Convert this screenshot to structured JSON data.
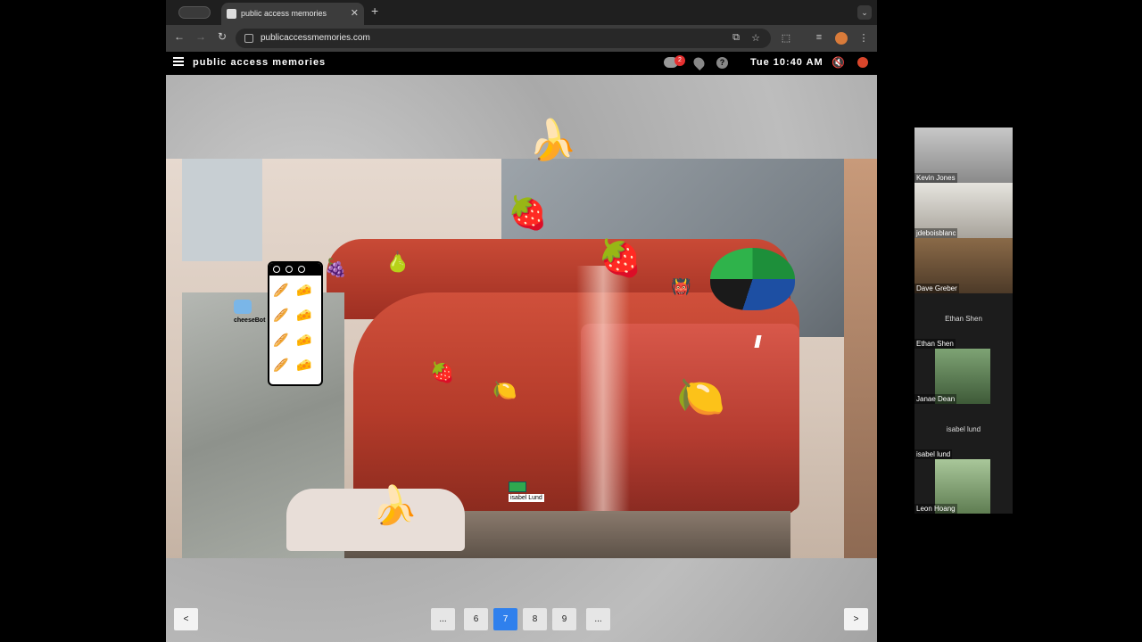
{
  "browser": {
    "tab_title": "public access memories",
    "tab_close": "✕",
    "new_tab": "+",
    "tab_menu": "⌄",
    "url": "publicaccessmemories.com",
    "back": "←",
    "forward": "→",
    "reload": "↻",
    "cast": "⧉",
    "star": "☆",
    "extensions": "⬚",
    "media": "≡",
    "menu": "⋮"
  },
  "site": {
    "name": "public access memories",
    "chat_badge": "2",
    "help": "?",
    "clock": "Tue 10:40 AM",
    "mute": "🔇"
  },
  "scene": {
    "bot_label": "cheeseBot",
    "user_label": "isabel Lund",
    "widget_items": [
      "🥖",
      "🧀",
      "🥖",
      "🧀",
      "🥖",
      "🧀",
      "🥖",
      "🧀"
    ],
    "fruits": {
      "banana": "🍌",
      "strawberry": "🍓",
      "lemon": "🍋",
      "pear": "🍐",
      "grapes": "🍇",
      "devil": "👹",
      "banana_peel": "🍌"
    }
  },
  "pagination": {
    "prev": "<",
    "next": ">",
    "pages": [
      "...",
      "6",
      "7",
      "8",
      "9",
      "..."
    ],
    "current": "7"
  },
  "participants": [
    {
      "name": "Kevin Jones",
      "video": true,
      "color": "#a9a9a9"
    },
    {
      "name": "jdeboisblanc",
      "video": true,
      "color": "#c8c2b8"
    },
    {
      "name": "Dave Greber",
      "video": true,
      "color": "#7a5a3a"
    },
    {
      "name": "Ethan Shen",
      "video": false,
      "center": "Ethan Shen"
    },
    {
      "name": "Janae Dean",
      "video": true,
      "color": "#5f8a5a"
    },
    {
      "name": "isabel lund",
      "video": false,
      "center": "isabel lund"
    },
    {
      "name": "Leon Hoang",
      "video": true,
      "color": "#8fae7c"
    }
  ]
}
